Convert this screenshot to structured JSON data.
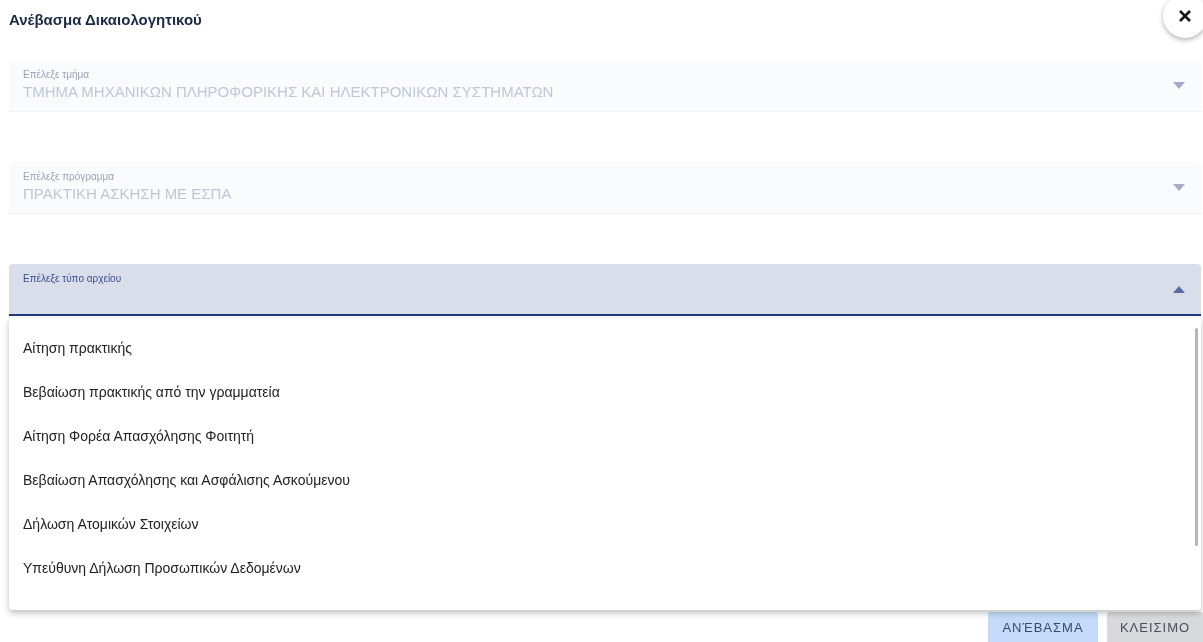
{
  "dialog": {
    "title": "Ανέβασμα Δικαιολογητικού"
  },
  "fields": [
    {
      "label": "Επέλεξε τμήμα",
      "value": "ΤΜΗΜΑ ΜΗΧΑΝΙΚΩΝ ΠΛΗΡΟΦΟΡΙΚΗΣ ΚΑΙ ΗΛΕΚΤΡΟΝΙΚΩΝ ΣΥΣΤΗΜΑΤΩΝ",
      "disabled": true,
      "expanded": false
    },
    {
      "label": "Επέλεξε πρόγραμμα",
      "value": "ΠΡΑΚΤΙΚΗ ΑΣΚΗΣΗ ΜΕ ΕΣΠΑ",
      "disabled": true,
      "expanded": false
    },
    {
      "label": "Επέλεξε τύπο αρχείου",
      "disabled": false,
      "expanded": true
    }
  ],
  "menu": {
    "options": [
      "Αίτηση πρακτικής",
      "Βεβαίωση πρακτικής από την γραμματεία",
      "Αίτηση Φορέα Απασχόλησης Φοιτητή",
      "Βεβαίωση Απασχόλησης και Ασφάλισης Ασκούμενου",
      "Δήλωση Ατομικών Στοιχείων",
      "Υπεύθυνη Δήλωση Προσωπικών Δεδομένων"
    ]
  },
  "buttons": [
    {
      "label": "ΑΝΈΒΑΣΜΑ",
      "kind": "primary"
    },
    {
      "label": "ΚΛΕΙΣΙΜΟ",
      "kind": "secondary"
    }
  ]
}
